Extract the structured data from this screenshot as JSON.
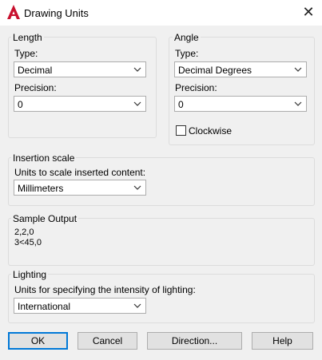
{
  "window": {
    "title": "Drawing Units",
    "app_icon": "autocad-a-icon",
    "close_icon": "close-icon"
  },
  "length": {
    "group_label": "Length",
    "type_label": "Type:",
    "type_value": "Decimal",
    "precision_label": "Precision:",
    "precision_value": "0"
  },
  "angle": {
    "group_label": "Angle",
    "type_label": "Type:",
    "type_value": "Decimal Degrees",
    "precision_label": "Precision:",
    "precision_value": "0",
    "clockwise_label": "Clockwise",
    "clockwise_checked": false
  },
  "insertion": {
    "group_label": "Insertion scale",
    "units_label": "Units to scale inserted content:",
    "units_value": "Millimeters"
  },
  "sample": {
    "group_label": "Sample Output",
    "line1": "2,2,0",
    "line2": "3<45,0"
  },
  "lighting": {
    "group_label": "Lighting",
    "units_label": "Units for specifying the intensity of lighting:",
    "units_value": "International"
  },
  "buttons": {
    "ok": "OK",
    "cancel": "Cancel",
    "direction": "Direction...",
    "help": "Help"
  },
  "colors": {
    "accent": "#0078d7",
    "app_red": "#c8102e",
    "dialog_bg": "#f0f0f0"
  }
}
